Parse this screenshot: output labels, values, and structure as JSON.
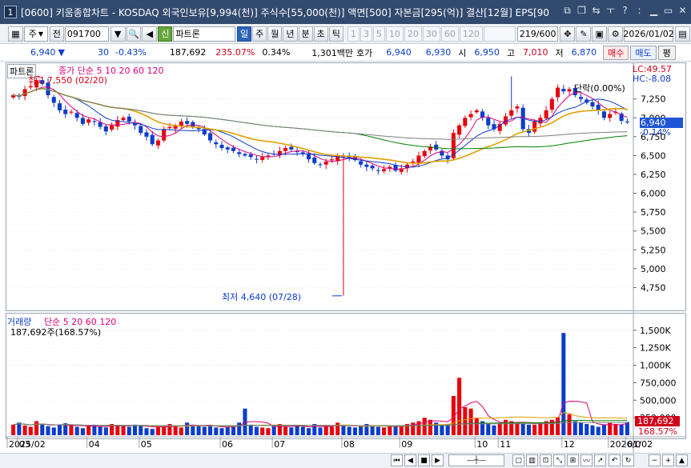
{
  "window": {
    "number": "1",
    "title": "[0600] 키움종합차트 - KOSDAQ 외국인보유[9,994(천)] 주식수[55,000(천)] 액면[500] 자본금[295(억)] 결산[12월] EPS[90"
  },
  "toolbar": {
    "period_select": "주",
    "all_label": "전",
    "code": "091700",
    "new_label": "신",
    "stock_name": "파트론",
    "period_tabs": [
      "일",
      "주",
      "월",
      "년",
      "분",
      "초",
      "틱"
    ],
    "active_period": "일",
    "intervals": [
      "1",
      "3",
      "5",
      "10",
      "20",
      "30",
      "60",
      "120"
    ],
    "count": "219/600",
    "date": "2026/01/02"
  },
  "quote": {
    "price": "6,940",
    "change": "30",
    "change_pct": "-0.43%",
    "volume": "187,692",
    "volume_ratio": "235.07%",
    "turnover": "0.34%",
    "amount": "1,301백만",
    "bid_label": "호가",
    "ask": "6,940",
    "bid": "6,930",
    "open_label": "시",
    "open": "6,950",
    "high_label": "고",
    "high": "7,010",
    "low_label": "저",
    "low": "6,870",
    "buy_label": "매수",
    "sell_label": "매도",
    "eval_label": "평"
  },
  "chart_data": [
    {
      "type": "candlestick",
      "legend_name": "파트론",
      "legend": "종가 단순 5  10  20  60  120",
      "ma_periods": [
        5,
        10,
        20,
        60,
        120
      ],
      "ma_colors": [
        "#e0007a",
        "#0a3ccc",
        "#e0a000",
        "#008000",
        "#808080"
      ],
      "high_annotation": "최고 7,550 (02/20)",
      "low_annotation": "최저 4,640 (07/28)",
      "ylim": [
        4500,
        7650
      ],
      "yticks": [
        "7,250",
        "7,000",
        "6,750",
        "6,500",
        "6,250",
        "6,000",
        "5,750",
        "5,500",
        "5,250",
        "5,000",
        "4,750"
      ],
      "ytick_values": [
        7250,
        7000,
        6750,
        6500,
        6250,
        6000,
        5750,
        5500,
        5250,
        5000,
        4750
      ],
      "lc_label": "LC:49.57",
      "hc_label": "HC:-8.08",
      "last_price_label": "6,940",
      "last_change_label": "-0.14%",
      "ma_status": "단락(0.00%)",
      "x_labels": [
        "2025/02",
        "03",
        "04",
        "05",
        "06",
        "07",
        "08",
        "09",
        "10",
        "11",
        "12",
        "2026/0",
        "01/02"
      ],
      "x_label_index": [
        0,
        1,
        13,
        22,
        36,
        45,
        57,
        67,
        80,
        84,
        95,
        103,
        106
      ],
      "closes": [
        7300,
        7280,
        7380,
        7420,
        7500,
        7450,
        7300,
        7200,
        7100,
        7050,
        7080,
        7000,
        6920,
        6980,
        6950,
        6880,
        6820,
        6900,
        6970,
        7000,
        6950,
        6900,
        6800,
        6750,
        6650,
        6700,
        6850,
        6880,
        6900,
        6950,
        6920,
        6880,
        6850,
        6780,
        6700,
        6650,
        6600,
        6580,
        6560,
        6520,
        6500,
        6480,
        6450,
        6480,
        6500,
        6520,
        6560,
        6600,
        6580,
        6550,
        6520,
        6450,
        6400,
        6380,
        6420,
        6450,
        6500,
        6480,
        6470,
        6440,
        6380,
        6350,
        6330,
        6300,
        6320,
        6350,
        6300,
        6330,
        6380,
        6420,
        6500,
        6560,
        6620,
        6580,
        6500,
        6450,
        6800,
        6900,
        7000,
        7050,
        7100,
        7000,
        6900,
        6850,
        6920,
        7020,
        7100,
        7150,
        6850,
        6800,
        6950,
        7000,
        7100,
        7250,
        7400,
        7350,
        7380,
        7300,
        7250,
        7200,
        7150,
        7100,
        7000,
        7050,
        7080,
        6960,
        6940
      ],
      "closes_note": "daily closes are estimated from the visible chart shape"
    },
    {
      "type": "bar",
      "legend_name": "거래량",
      "legend": "단순 5  20  60  120",
      "current_label": "187,692주(168.57%)",
      "yticks": [
        "1,500K",
        "1,250K",
        "1,000K",
        "750,000",
        "500,000",
        "250,000"
      ],
      "ytick_values": [
        1500000,
        1250000,
        1000000,
        750000,
        500000,
        250000
      ],
      "ylim": [
        0,
        1600000
      ],
      "last_label": "187,692",
      "last_pct_label": "168.57%",
      "values": [
        150000,
        180000,
        140000,
        120000,
        200000,
        160000,
        130000,
        110000,
        150000,
        170000,
        140000,
        120000,
        100000,
        130000,
        150000,
        120000,
        110000,
        160000,
        140000,
        130000,
        120000,
        150000,
        140000,
        100000,
        90000,
        120000,
        140000,
        160000,
        120000,
        110000,
        180000,
        150000,
        140000,
        120000,
        130000,
        110000,
        100000,
        120000,
        140000,
        180000,
        380000,
        150000,
        120000,
        110000,
        100000,
        130000,
        160000,
        120000,
        110000,
        140000,
        120000,
        100000,
        160000,
        110000,
        140000,
        120000,
        180000,
        130000,
        120000,
        110000,
        140000,
        160000,
        130000,
        120000,
        110000,
        130000,
        120000,
        140000,
        160000,
        180000,
        200000,
        250000,
        220000,
        180000,
        150000,
        160000,
        560000,
        820000,
        400000,
        380000,
        250000,
        200000,
        160000,
        140000,
        170000,
        220000,
        200000,
        180000,
        160000,
        150000,
        150000,
        180000,
        200000,
        220000,
        250000,
        1460000,
        300000,
        200000,
        180000,
        160000,
        140000,
        120000,
        150000,
        180000,
        160000,
        150000,
        187692
      ]
    }
  ]
}
